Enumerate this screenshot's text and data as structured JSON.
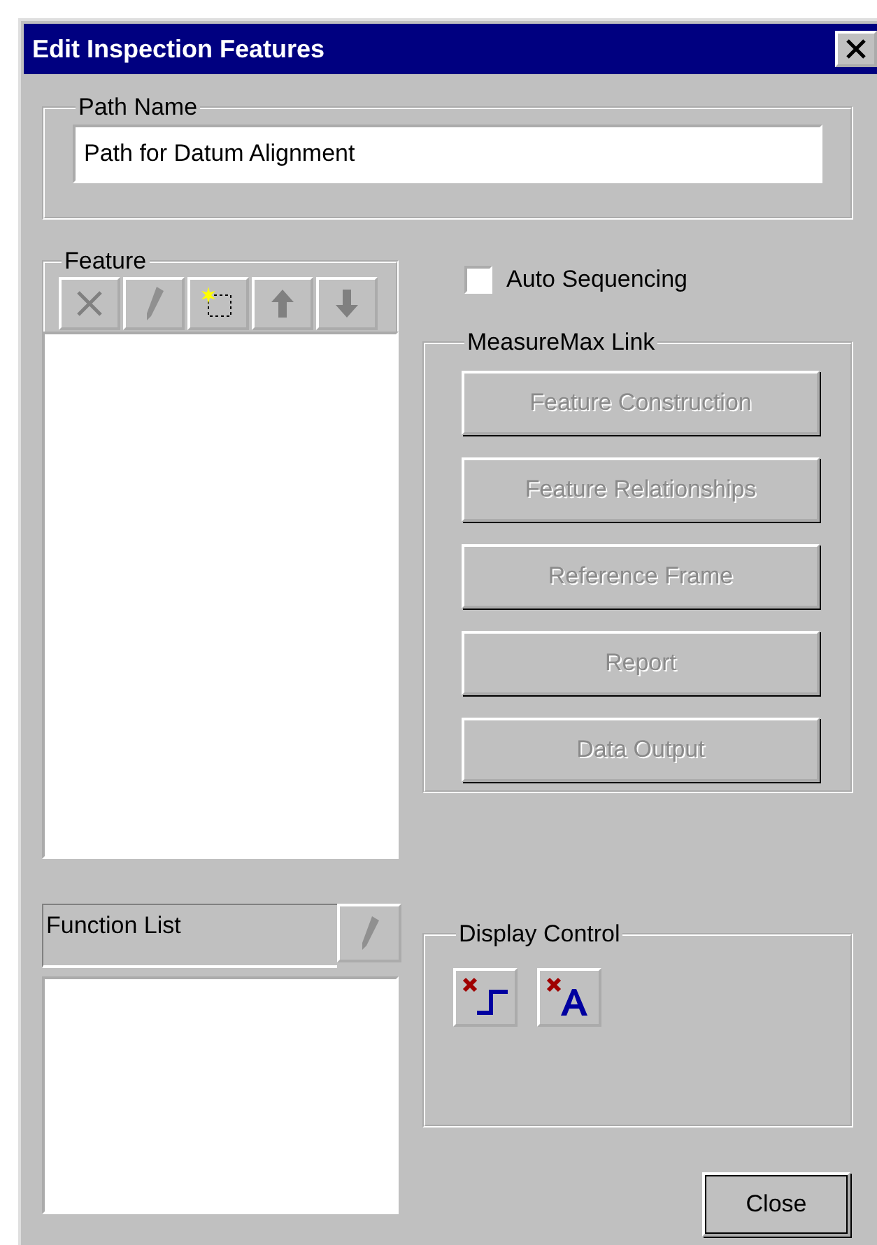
{
  "window": {
    "title": "Edit Inspection Features"
  },
  "path_name": {
    "label": "Path Name",
    "value": "Path for Datum Alignment"
  },
  "feature": {
    "label": "Feature",
    "toolbar": [
      {
        "kind": "delete",
        "disabled": true
      },
      {
        "kind": "edit",
        "disabled": true
      },
      {
        "kind": "new",
        "disabled": false
      },
      {
        "kind": "up",
        "disabled": true
      },
      {
        "kind": "down",
        "disabled": true
      }
    ]
  },
  "auto_sequencing": {
    "label": "Auto Sequencing",
    "checked": false
  },
  "measuremax_link": {
    "label": "MeasureMax Link",
    "buttons": [
      {
        "label": "Feature Construction",
        "disabled": true
      },
      {
        "label": "Feature Relationships",
        "disabled": true
      },
      {
        "label": "Reference Frame",
        "disabled": true
      },
      {
        "label": "Report",
        "disabled": true
      },
      {
        "label": "Data Output",
        "disabled": true
      }
    ]
  },
  "function_list": {
    "label": "Function List",
    "edit_disabled": true
  },
  "display_control": {
    "label": "Display Control",
    "buttons": [
      {
        "kind": "step"
      },
      {
        "kind": "text"
      }
    ]
  },
  "close_button": {
    "label": "Close"
  }
}
